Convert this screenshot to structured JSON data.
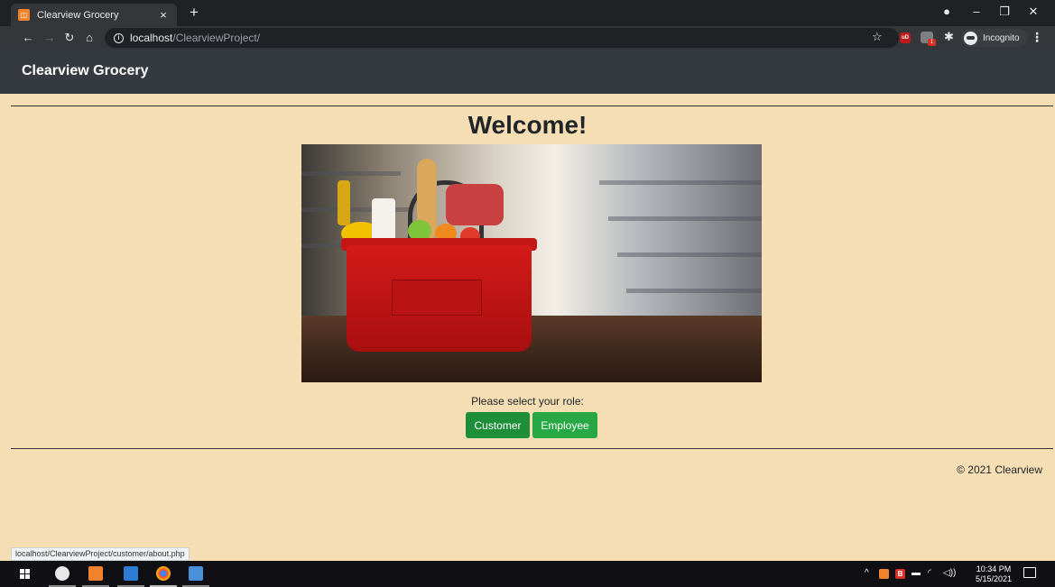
{
  "browser": {
    "tab_title": "Clearview Grocery",
    "tab_close": "×",
    "new_tab": "+",
    "url_host": "localhost",
    "url_path": "/ClearviewProject/",
    "incognito_label": "Incognito",
    "extension_badge": "1",
    "extension_ub": "uD",
    "status_url": "localhost/ClearviewProject/customer/about.php",
    "icons": [
      "back-icon",
      "forward-icon",
      "reload-icon",
      "home-icon",
      "info-icon",
      "star-icon",
      "puzzle-icon",
      "menu-dots-icon"
    ]
  },
  "site": {
    "brand": "Clearview Grocery",
    "heading": "Welcome!",
    "role_prompt": "Please select your role:",
    "buttons": {
      "customer": "Customer",
      "employee": "Employee"
    },
    "footer": "© 2021 Clearview",
    "colors": {
      "navbar": "#343a40",
      "background": "#f5deb3",
      "button": "#28a745"
    }
  },
  "taskbar": {
    "time": "10:34 PM",
    "date": "5/15/2021",
    "tray_badge": "B"
  }
}
